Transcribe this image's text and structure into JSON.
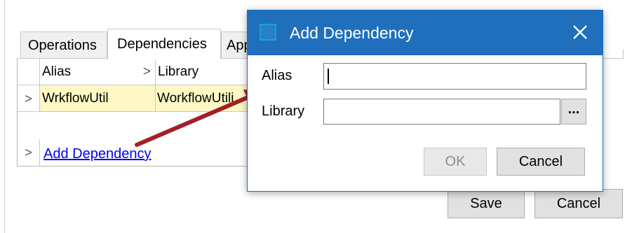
{
  "tabs": [
    {
      "label": "Operations"
    },
    {
      "label": "Dependencies"
    },
    {
      "label": "App"
    }
  ],
  "grid": {
    "columns": [
      "Alias",
      "Library"
    ],
    "header_sort_glyph": ">",
    "rows": [
      {
        "marker": ">",
        "alias": "WrkflowUtil",
        "library": "WorkflowUtili"
      }
    ],
    "add_row_marker": ">",
    "add_link": "Add Dependency"
  },
  "main_buttons": {
    "save": "Save",
    "cancel": "Cancel"
  },
  "dialog": {
    "title": "Add Dependency",
    "close_icon": "close-icon",
    "alias_label": "Alias",
    "alias_value": "",
    "library_label": "Library",
    "library_value": "",
    "browse_label": "...",
    "ok_label": "OK",
    "cancel_label": "Cancel"
  },
  "colors": {
    "titlebar": "#1f6fbd",
    "row_highlight": "#fff8c4",
    "link": "#0000ee",
    "annotation_arrow": "#a31f27"
  }
}
